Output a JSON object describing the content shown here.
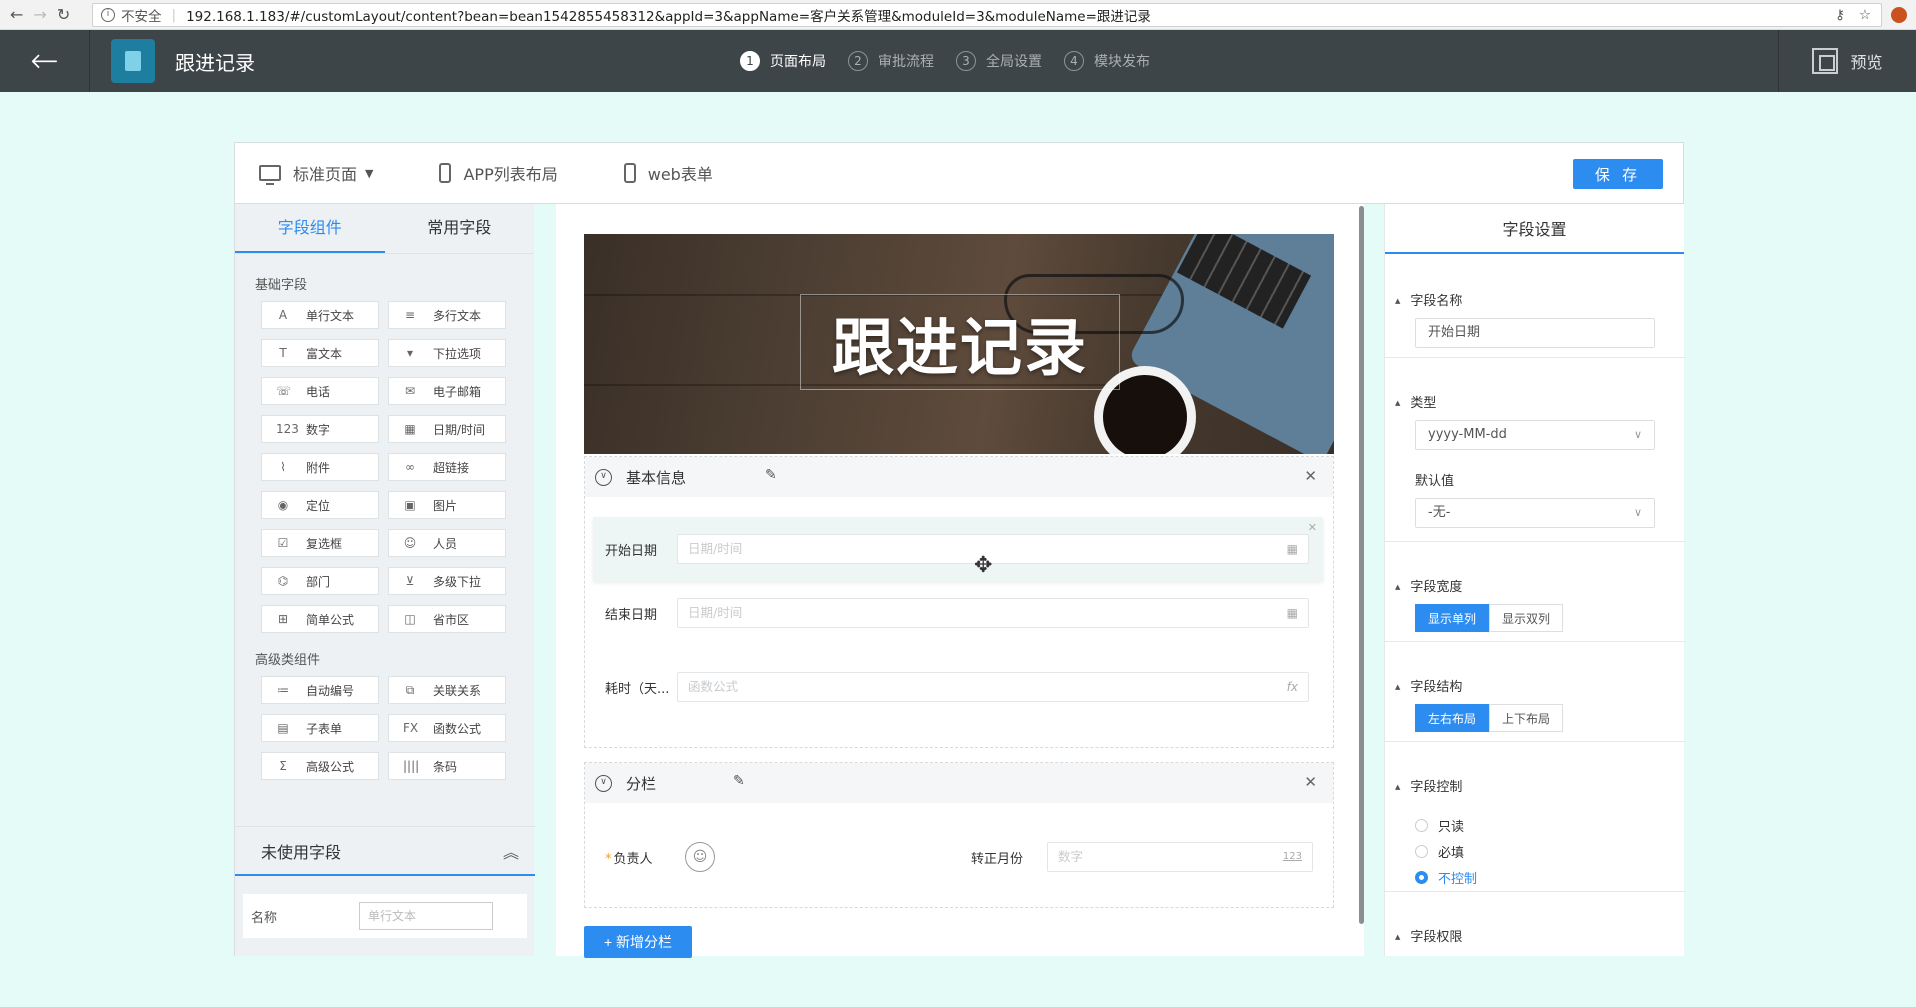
{
  "browser": {
    "security": "不安全",
    "url": "192.168.1.183/#/customLayout/content?bean=bean1542855458312&appId=3&appName=客户关系管理&moduleId=3&moduleName=跟进记录"
  },
  "header": {
    "module_title": "跟进记录",
    "steps": [
      {
        "num": "1",
        "label": "页面布局"
      },
      {
        "num": "2",
        "label": "审批流程"
      },
      {
        "num": "3",
        "label": "全局设置"
      },
      {
        "num": "4",
        "label": "模块发布"
      }
    ],
    "preview_label": "预览"
  },
  "toolbar": {
    "standard_page": "标准页面",
    "app_list_layout": "APP列表布局",
    "web_form": "web表单",
    "save_label": "保 存"
  },
  "left_panel": {
    "tabs": [
      "字段组件",
      "常用字段"
    ],
    "basic_section": "基础字段",
    "basic_fields": [
      {
        "icon": "A",
        "label": "单行文本"
      },
      {
        "icon": "≡",
        "label": "多行文本"
      },
      {
        "icon": "T",
        "label": "富文本"
      },
      {
        "icon": "▾",
        "label": "下拉选项"
      },
      {
        "icon": "☏",
        "label": "电话"
      },
      {
        "icon": "✉",
        "label": "电子邮箱"
      },
      {
        "icon": "123",
        "label": "数字"
      },
      {
        "icon": "▦",
        "label": "日期/时间"
      },
      {
        "icon": "⌇",
        "label": "附件"
      },
      {
        "icon": "∞",
        "label": "超链接"
      },
      {
        "icon": "◉",
        "label": "定位"
      },
      {
        "icon": "▣",
        "label": "图片"
      },
      {
        "icon": "☑",
        "label": "复选框"
      },
      {
        "icon": "☺",
        "label": "人员"
      },
      {
        "icon": "⌬",
        "label": "部门"
      },
      {
        "icon": "⊻",
        "label": "多级下拉"
      },
      {
        "icon": "⊞",
        "label": "简单公式"
      },
      {
        "icon": "◫",
        "label": "省市区"
      }
    ],
    "advanced_section": "高级类组件",
    "advanced_fields": [
      {
        "icon": "≔",
        "label": "自动编号"
      },
      {
        "icon": "⧉",
        "label": "关联关系"
      },
      {
        "icon": "▤",
        "label": "子表单"
      },
      {
        "icon": "FX",
        "label": "函数公式"
      },
      {
        "icon": "Σ",
        "label": "高级公式"
      },
      {
        "icon": "||||",
        "label": "条码"
      }
    ],
    "unused_title": "未使用字段",
    "unused_row": {
      "label": "名称",
      "placeholder": "单行文本"
    }
  },
  "canvas": {
    "banner_title": "跟进记录",
    "group1": {
      "title": "基本信息",
      "fields": [
        {
          "label": "开始日期",
          "placeholder": "日期/时间",
          "tail": "▦"
        },
        {
          "label": "结束日期",
          "placeholder": "日期/时间",
          "tail": "▦"
        },
        {
          "label": "耗时（天...",
          "placeholder": "函数公式",
          "tail": "fx"
        }
      ]
    },
    "group2": {
      "title": "分栏",
      "owner_label": "负责人",
      "month_label": "转正月份",
      "month_placeholder": "数字",
      "month_tail": "123"
    },
    "add_button": "+ 新增分栏"
  },
  "right_panel": {
    "title": "字段设置",
    "name_heading": "字段名称",
    "name_value": "开始日期",
    "type_heading": "类型",
    "type_value": "yyyy-MM-dd",
    "default_label": "默认值",
    "default_value": "-无-",
    "width_heading": "字段宽度",
    "width_options": [
      "显示单列",
      "显示双列"
    ],
    "structure_heading": "字段结构",
    "structure_options": [
      "左右布局",
      "上下布局"
    ],
    "control_heading": "字段控制",
    "control_options": [
      "只读",
      "必填",
      "不控制"
    ],
    "permission_heading": "字段权限"
  }
}
